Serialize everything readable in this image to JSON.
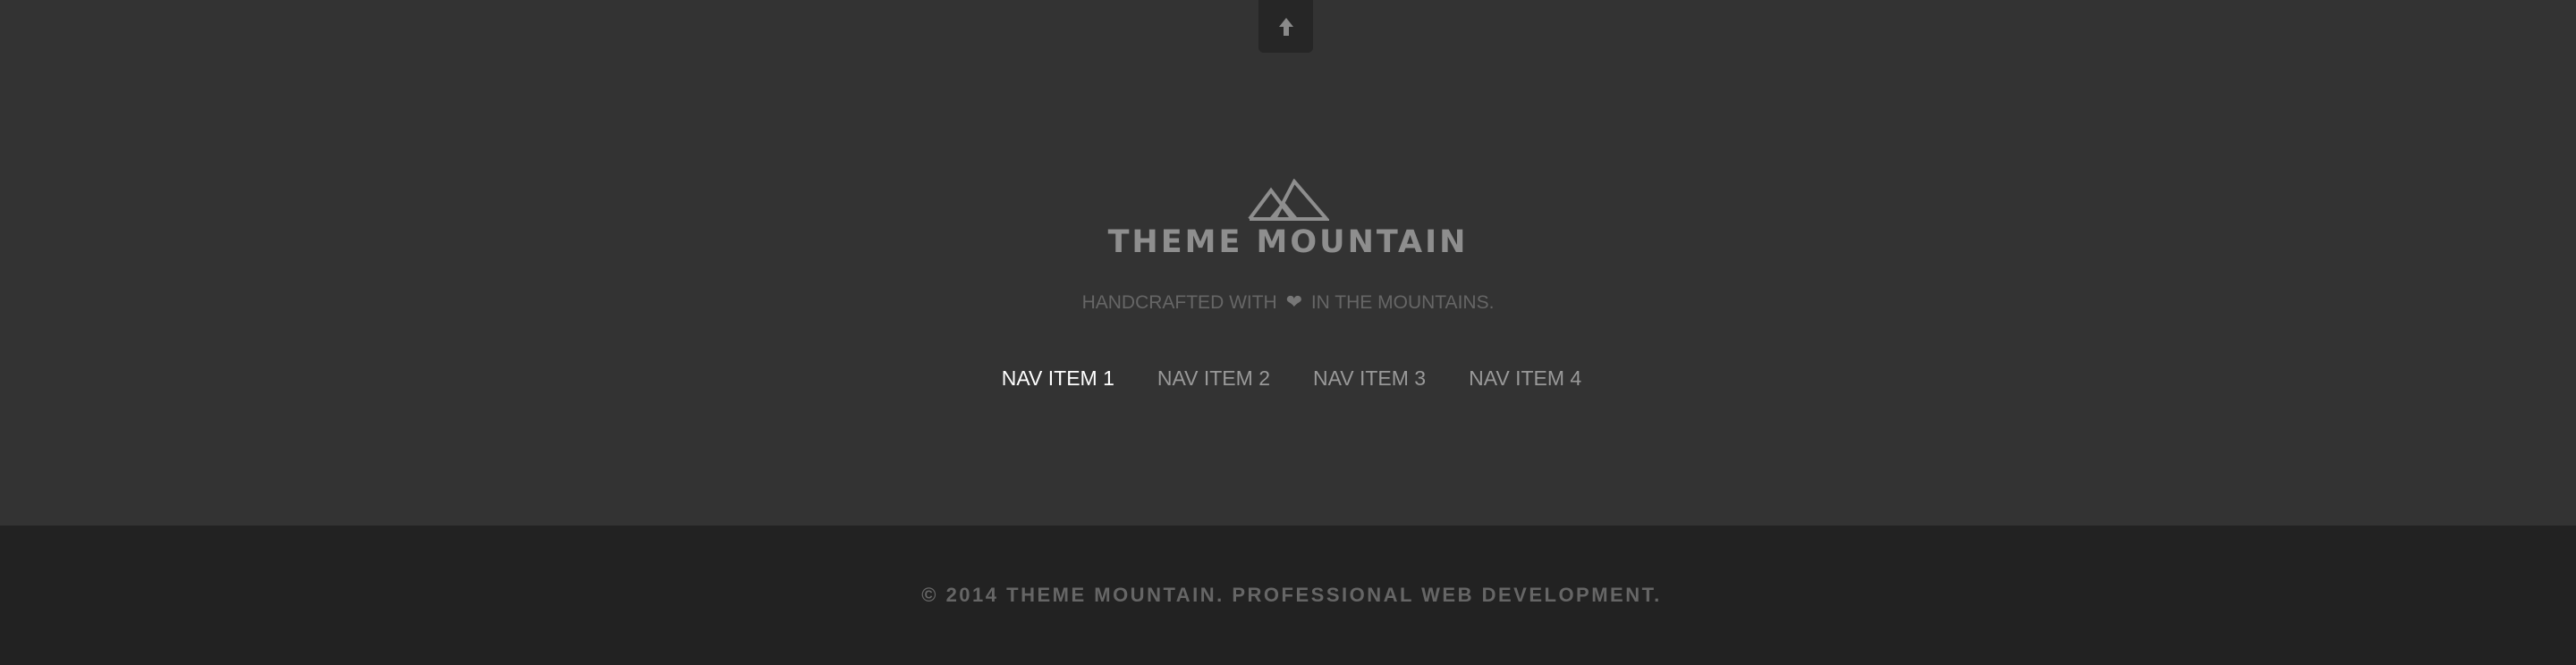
{
  "back_to_top": {
    "icon": "arrow-up-icon"
  },
  "brand": {
    "logo_icon": "mountain-logo-icon",
    "name": "THEME MOUNTAIN"
  },
  "tagline": {
    "before": "HANDCRAFTED WITH",
    "icon": "heart-icon",
    "after": "IN THE MOUNTAINS."
  },
  "nav": {
    "items": [
      {
        "label": "NAV ITEM 1",
        "active": true
      },
      {
        "label": "NAV ITEM 2",
        "active": false
      },
      {
        "label": "NAV ITEM 3",
        "active": false
      },
      {
        "label": "NAV ITEM 4",
        "active": false
      }
    ]
  },
  "footer": {
    "copyright": "© 2014 THEME MOUNTAIN. PROFESSIONAL WEB DEVELOPMENT."
  },
  "colors": {
    "background": "#333333",
    "footer_bar": "#222222",
    "logo": "#8e8e8e",
    "nav_active": "#ffffff",
    "nav_inactive": "#999999",
    "muted_text": "#666666"
  }
}
